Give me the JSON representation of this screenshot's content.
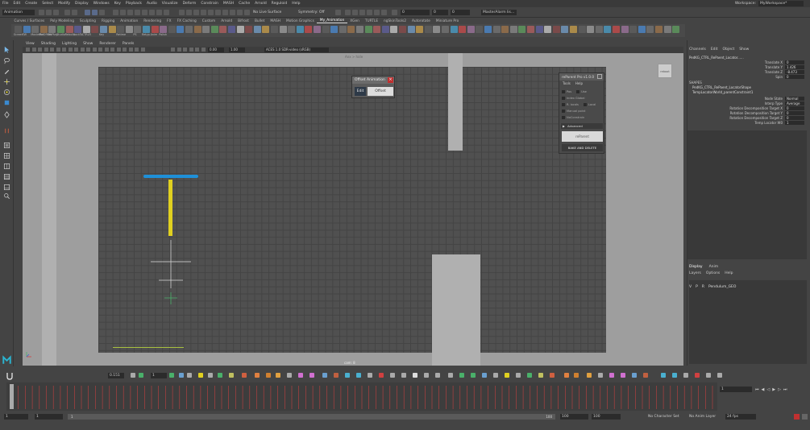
{
  "menubar": {
    "items": [
      "File",
      "Edit",
      "Create",
      "Select",
      "Modify",
      "Display",
      "Windows",
      "Key",
      "Playback",
      "Audio",
      "Visualize",
      "Deform",
      "Constrain",
      "MASH",
      "Cache",
      "Arnold",
      "Reguloid",
      "Help"
    ],
    "workspace_label": "Workspace:",
    "workspace_value": "MyWorkspace*"
  },
  "statusline": {
    "mode": "Animation",
    "no_live_surface": "No Live Surface",
    "symmetry": "Symmetry: Off",
    "field1": "0",
    "field2": "0",
    "field3": "0",
    "camera": "MasterAlarm lis..."
  },
  "shelftabs": {
    "tabs": [
      "Curves / Surfaces",
      "Poly Modeling",
      "Sculpting",
      "Rigging",
      "Animation",
      "Rendering",
      "FX",
      "FX Caching",
      "Custom",
      "Arnold",
      "Bifrost",
      "Bullet",
      "MASH",
      "Motion Graphics",
      "My_Animation",
      "XGen",
      "TURTLE",
      "ngSkinTools2",
      "Autorotate",
      "Miniature Pro"
    ],
    "active_index": 14
  },
  "shelf": {
    "labels": [
      "Screen",
      "TW",
      "Moviefilm",
      "PxlOffset",
      "TrkPlay",
      "Studio",
      "Rebuild",
      "LockTo",
      "CTRLR",
      "",
      "Key",
      "",
      "Retime",
      "",
      "PS",
      "Retyp",
      "Anim",
      "Polish"
    ]
  },
  "viewport": {
    "menu": [
      "View",
      "Shading",
      "Lighting",
      "Show",
      "Renderer",
      "Panels"
    ],
    "toolbar_value1": "0.00",
    "toolbar_value2": "1.00",
    "colorspace": "ACES 1.0 SDR-video (sRGB)",
    "camera_name": "Anx > hide",
    "frame_counter": "cam: 8",
    "corner_button": "reboot"
  },
  "offset_window": {
    "title": "Offset Animation",
    "edit": "Edit",
    "offset": "Offset"
  },
  "reparent_window": {
    "title": "reParent Pro v1.0.0",
    "menu": [
      "Tools",
      "Help"
    ],
    "rows": [
      {
        "label": "Pos",
        "extra": "Use"
      },
      {
        "label": "Index Global",
        "extra": ""
      },
      {
        "label": "R. locals",
        "extra": "Local"
      },
      {
        "label": "Manual point",
        "extra": ""
      },
      {
        "label": "NoConstrain",
        "extra": ""
      }
    ],
    "advanced": "Advanced",
    "reparent_button": "reParent",
    "bake_button": "BAKE AND DELETE"
  },
  "channelbox": {
    "menu": [
      "Channels",
      "Edit",
      "Object",
      "Show"
    ],
    "object": "PedKG_CTRL_RePaent_Locator......",
    "attrs": [
      {
        "name": "Translate X",
        "value": "0"
      },
      {
        "name": "Translate Y",
        "value": "1.426"
      },
      {
        "name": "Translate Z",
        "value": "-8.473"
      },
      {
        "name": "Spin",
        "value": "0"
      }
    ],
    "shapes_header": "SHAPES",
    "shape1": "PedKG_CTRL_RePaent_LocatorShape",
    "shape2": "TempLocatorWorld_parentConstraint1",
    "shape_attrs": [
      {
        "name": "Node State",
        "value": "Normal"
      },
      {
        "name": "Interp Type",
        "value": "Average"
      },
      {
        "name": "Rotation Decomposition Target X",
        "value": "0"
      },
      {
        "name": "Rotation Decomposition Target Y",
        "value": "0"
      },
      {
        "name": "Rotation Decomposition Target Z",
        "value": "0"
      },
      {
        "name": "Temp Locator W0",
        "value": "1"
      }
    ]
  },
  "layer_editor": {
    "tabs": [
      "Display",
      "Anim"
    ],
    "menu": [
      "Layers",
      "Options",
      "Help"
    ],
    "row_v": "V",
    "row_p": "P",
    "row_r": "R",
    "row_name": "Pendulum_GEO"
  },
  "timeslider": {
    "current_value": "0.151",
    "step_value": "1",
    "current_frame": "1"
  },
  "rangebar": {
    "start": "1",
    "start2": "1",
    "range_start_marker": "1",
    "range_end_marker": "100",
    "end1": "100",
    "end2": "100",
    "character_set": "No Character Set",
    "anim_layer": "No Anim Layer",
    "fps": "24 fps"
  },
  "colors": {
    "blue_bar": "#1e90d8",
    "yellow_bar": "#e0d020",
    "green_line": "#a8c040",
    "keyframe_red": "#c04040",
    "maya_m": "#2ab4d0"
  }
}
